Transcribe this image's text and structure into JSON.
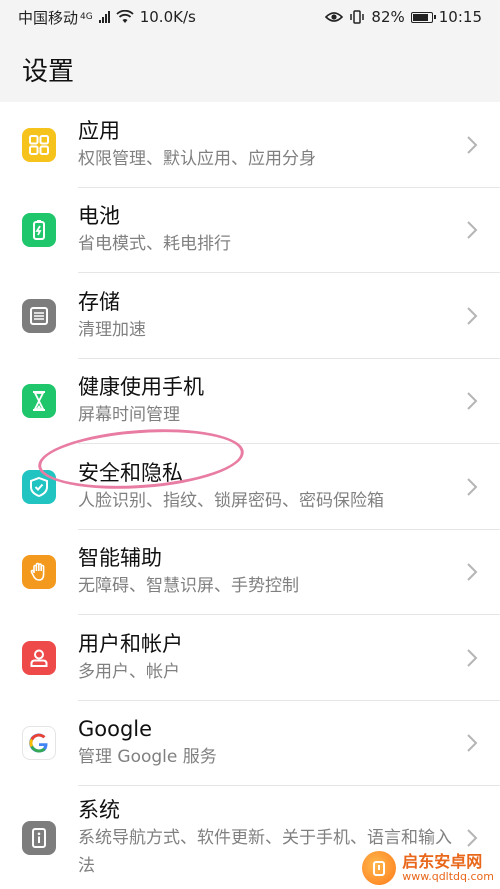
{
  "status_bar": {
    "carrier": "中国移动",
    "network": "4G",
    "speed": "10.0K/s",
    "battery": "82%",
    "time": "10:15",
    "icons": [
      "signal-icon",
      "wifi-icon",
      "eye-icon",
      "vibrate-icon",
      "battery-icon"
    ]
  },
  "header": {
    "title": "设置"
  },
  "items": [
    {
      "title": "应用",
      "subtitle": "权限管理、默认应用、应用分身",
      "icon": "apps-icon",
      "color": "#f6c21c"
    },
    {
      "title": "电池",
      "subtitle": "省电模式、耗电排行",
      "icon": "battery-icon",
      "color": "#1fc66b"
    },
    {
      "title": "存储",
      "subtitle": "清理加速",
      "icon": "storage-icon",
      "color": "#7d7d7d"
    },
    {
      "title": "健康使用手机",
      "subtitle": "屏幕时间管理",
      "icon": "hourglass-icon",
      "color": "#1fc66b"
    },
    {
      "title": "安全和隐私",
      "subtitle": "人脸识别、指纹、锁屏密码、密码保险箱",
      "icon": "shield-icon",
      "color": "#22c4c1"
    },
    {
      "title": "智能辅助",
      "subtitle": "无障碍、智慧识屏、手势控制",
      "icon": "hand-icon",
      "color": "#f39a1e"
    },
    {
      "title": "用户和帐户",
      "subtitle": "多用户、帐户",
      "icon": "user-icon",
      "color": "#ef4a4a"
    },
    {
      "title": "Google",
      "subtitle": "管理 Google 服务",
      "icon": "google-icon",
      "color": "#ffffff"
    },
    {
      "title": "系统",
      "subtitle": "系统导航方式、软件更新、关于手机、语言和输入法",
      "icon": "info-icon",
      "color": "#7d7d7d"
    }
  ],
  "watermark": {
    "title": "启东安卓网",
    "url": "www.qdltdq.com"
  },
  "annotation_color": "#e87ca3"
}
